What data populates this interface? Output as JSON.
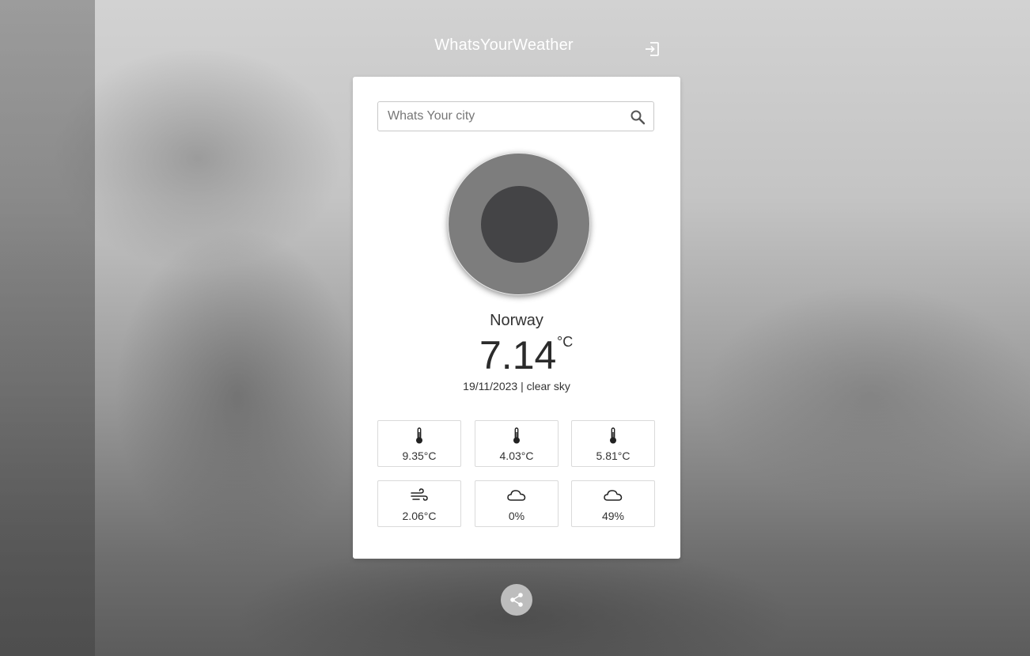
{
  "header": {
    "title": "WhatsYourWeather",
    "logout_icon": "logout-icon"
  },
  "search": {
    "placeholder": "Whats Your city",
    "value": "",
    "icon": "search-icon"
  },
  "weather": {
    "city": "Norway",
    "temperature": "7.14",
    "unit": "°C",
    "date_description": "19/11/2023 | clear sky"
  },
  "stats": [
    {
      "icon": "thermometer-icon",
      "value": "9.35°C"
    },
    {
      "icon": "thermometer-icon",
      "value": "4.03°C"
    },
    {
      "icon": "thermometer-icon",
      "value": "5.81°C"
    },
    {
      "icon": "wind-icon",
      "value": "2.06°C"
    },
    {
      "icon": "cloud-icon",
      "value": "0%"
    },
    {
      "icon": "cloud-icon",
      "value": "49%"
    }
  ],
  "footer": {
    "share_icon": "share-icon"
  },
  "colors": {
    "card": "#ffffff",
    "title": "#ffffff",
    "icon_outer": "#7d7d7d",
    "icon_inner": "#444446",
    "share_button": "#bdbdbd"
  }
}
